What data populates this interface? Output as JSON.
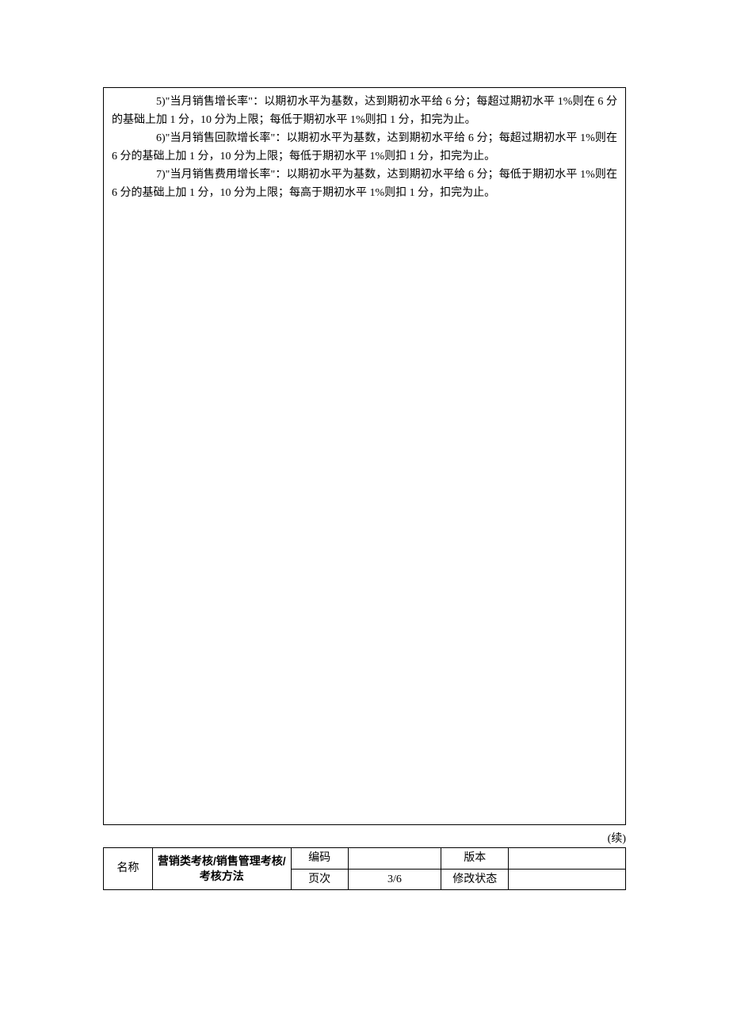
{
  "body": {
    "item5": "5)\"当月销售增长率\"：以期初水平为基数，达到期初水平给 6 分；每超过期初水平 1%则在 6 分的基础上加 1 分，10 分为上限；每低于期初水平 1%则扣 1 分，扣完为止。",
    "item6": "6)\"当月销售回款增长率\"：以期初水平为基数，达到期初水平给 6 分；每超过期初水平 1%则在 6 分的基础上加 1 分，10 分为上限；每低于期初水平 1%则扣 1 分，扣完为止。",
    "item7": "7)\"当月销售费用增长率\"：以期初水平为基数，达到期初水平给 6 分；每低于期初水平 1%则在 6 分的基础上加 1 分，10 分为上限；每高于期初水平 1%则扣 1 分，扣完为止。"
  },
  "continued_label": "(续)",
  "footer": {
    "row_label": "名称",
    "title": "营销类考核/销售管理考核/考核方法",
    "code_label": "编码",
    "code_value": "",
    "version_label": "版本",
    "version_value": "",
    "page_label": "页次",
    "page_value": "3/6",
    "revision_label": "修改状态",
    "revision_value": ""
  }
}
